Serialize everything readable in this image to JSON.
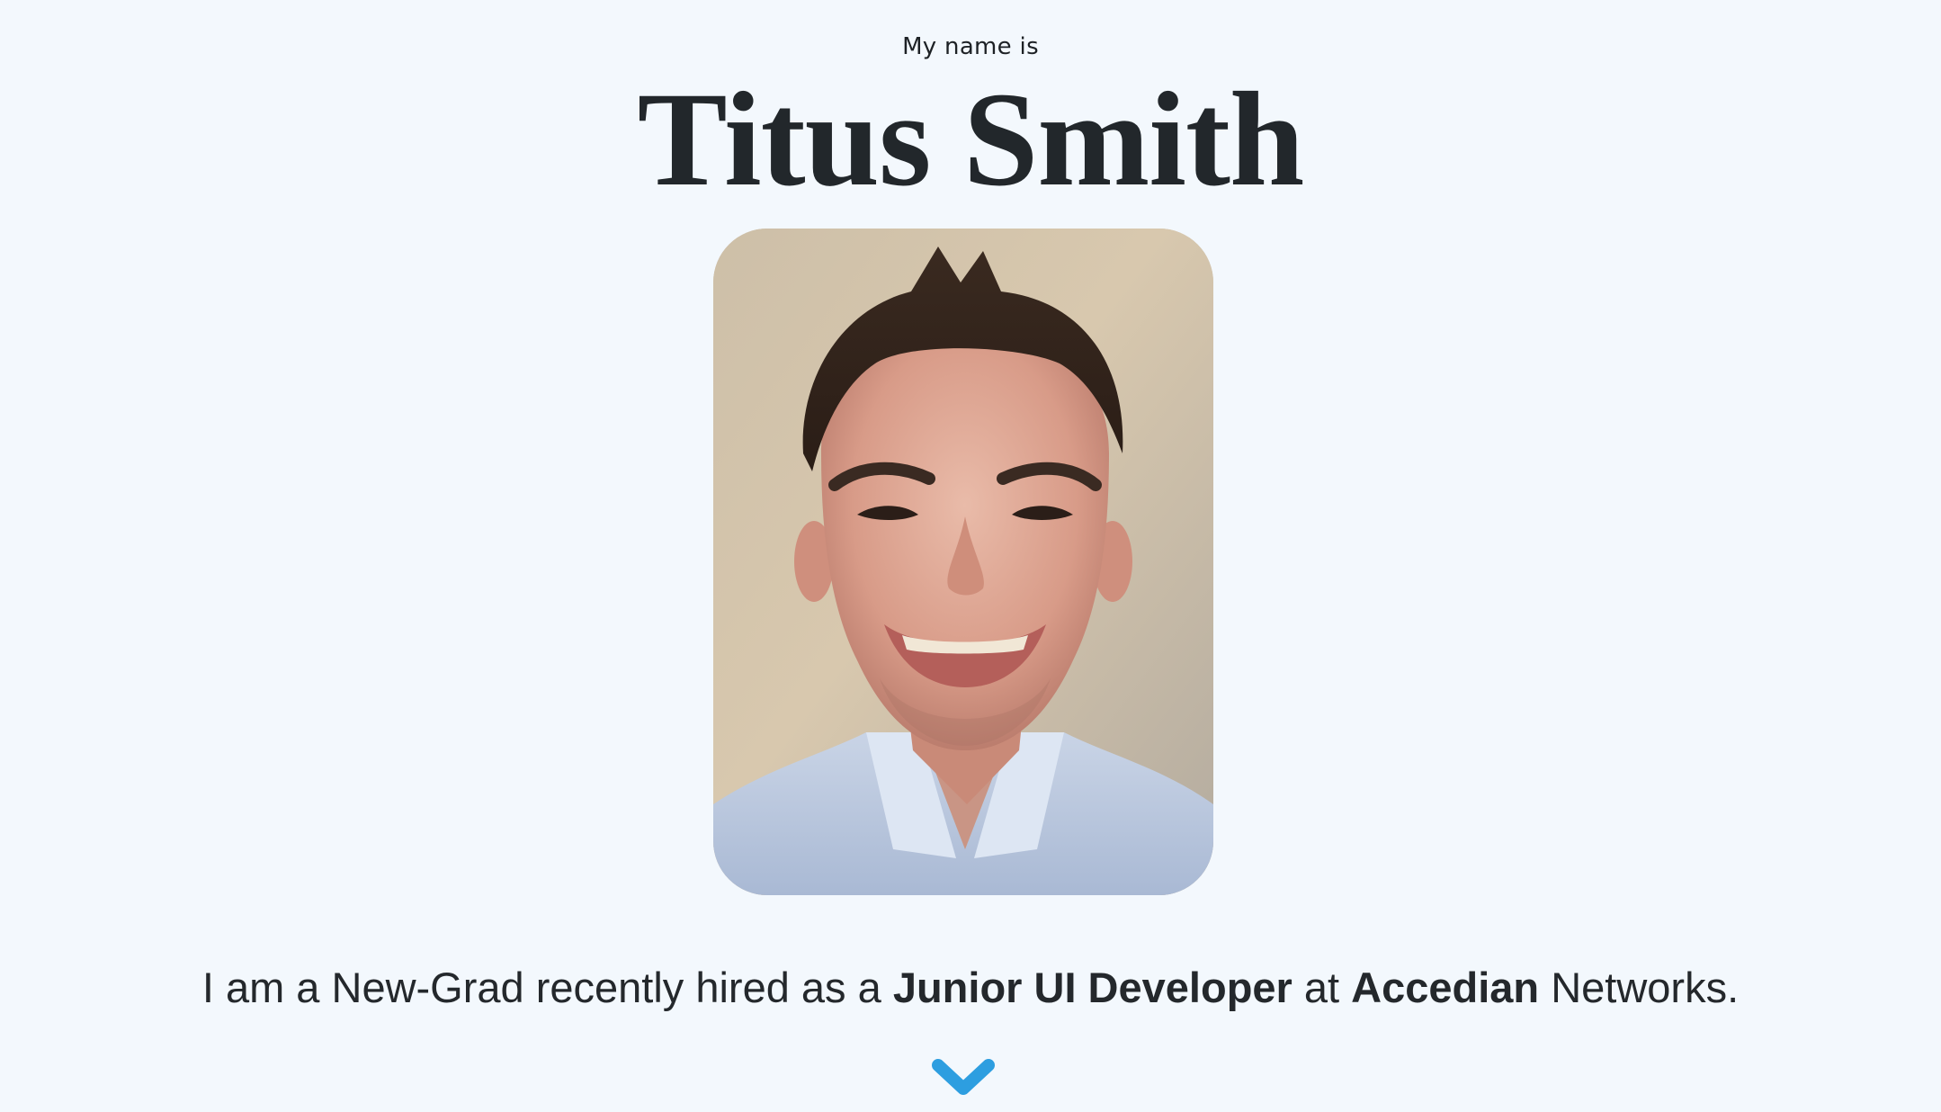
{
  "hero": {
    "eyebrow": "My name is",
    "name": "Titus Smith",
    "portrait_alt": "Portrait photo of Titus Smith",
    "intro": {
      "part1": "I am a New-Grad recently hired as a ",
      "role": "Junior UI Developer",
      "part2": " at ",
      "company": "Accedian",
      "part3": " Networks."
    },
    "scroll_icon": "chevron-down-icon"
  },
  "colors": {
    "background": "#f3f8fd",
    "text": "#22272b",
    "accent": "#2d9ee0"
  }
}
